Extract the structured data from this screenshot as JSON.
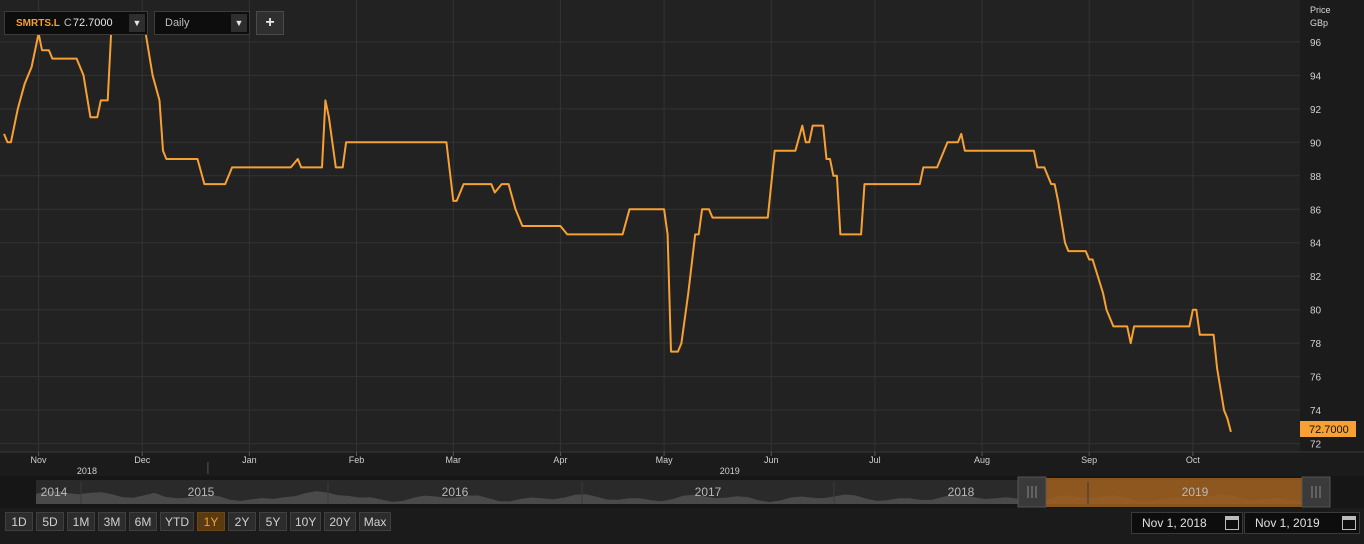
{
  "toolbar": {
    "symbol": "SMRTS.L",
    "close_label": "C",
    "close_value": "72.7000",
    "interval": "Daily",
    "add_label": "+"
  },
  "axis": {
    "title_line1": "Price",
    "title_line2": "GBp",
    "last_price": "72.7000"
  },
  "navigator": {
    "years": [
      "2014",
      "2015",
      "2016",
      "2017",
      "2018",
      "2019"
    ]
  },
  "range_buttons": [
    "1D",
    "5D",
    "1M",
    "3M",
    "6M",
    "YTD",
    "1Y",
    "2Y",
    "5Y",
    "10Y",
    "20Y",
    "Max"
  ],
  "active_range": "1Y",
  "dates": {
    "start": "Nov 1, 2018",
    "end": "Nov 1, 2019"
  },
  "colors": {
    "line": "#f7a033",
    "background": "#222222",
    "grid": "#3a3a3a",
    "navigator_selection": "#a05f1e"
  },
  "chart_data": {
    "type": "line",
    "title": "",
    "xlabel": "",
    "ylabel": "Price GBp",
    "ylim": [
      71.5,
      98.5
    ],
    "y_ticks": [
      72,
      74,
      76,
      78,
      80,
      82,
      84,
      86,
      88,
      90,
      92,
      94,
      96
    ],
    "month_ticks": [
      {
        "label": "Nov",
        "x": "2018-11-01"
      },
      {
        "label": "Dec",
        "x": "2018-12-01"
      },
      {
        "label": "Jan",
        "x": "2019-01-01"
      },
      {
        "label": "Feb",
        "x": "2019-02-01"
      },
      {
        "label": "Mar",
        "x": "2019-03-01"
      },
      {
        "label": "Apr",
        "x": "2019-04-01"
      },
      {
        "label": "May",
        "x": "2019-05-01"
      },
      {
        "label": "Jun",
        "x": "2019-06-01"
      },
      {
        "label": "Jul",
        "x": "2019-07-01"
      },
      {
        "label": "Aug",
        "x": "2019-08-01"
      },
      {
        "label": "Sep",
        "x": "2019-09-01"
      },
      {
        "label": "Oct",
        "x": "2019-10-01"
      }
    ],
    "year_labels": [
      {
        "label": "2018",
        "x": "2018-11-15"
      },
      {
        "label": "2019",
        "x": "2019-05-20"
      }
    ],
    "x_range": [
      "2018-10-22",
      "2019-11-01"
    ],
    "series": [
      {
        "name": "SMRTS.L",
        "points": [
          [
            "2018-10-22",
            90.5
          ],
          [
            "2018-10-23",
            90.0
          ],
          [
            "2018-10-24",
            90.0
          ],
          [
            "2018-10-26",
            92.0
          ],
          [
            "2018-10-28",
            93.5
          ],
          [
            "2018-10-30",
            94.5
          ],
          [
            "2018-11-01",
            96.5
          ],
          [
            "2018-11-02",
            95.5
          ],
          [
            "2018-11-04",
            95.5
          ],
          [
            "2018-11-05",
            95.0
          ],
          [
            "2018-11-12",
            95.0
          ],
          [
            "2018-11-14",
            94.0
          ],
          [
            "2018-11-16",
            91.5
          ],
          [
            "2018-11-18",
            91.5
          ],
          [
            "2018-11-19",
            92.5
          ],
          [
            "2018-11-21",
            92.5
          ],
          [
            "2018-11-22",
            96.5
          ],
          [
            "2018-12-02",
            96.5
          ],
          [
            "2018-12-04",
            94.0
          ],
          [
            "2018-12-06",
            92.5
          ],
          [
            "2018-12-07",
            89.5
          ],
          [
            "2018-12-08",
            89.0
          ],
          [
            "2018-12-17",
            89.0
          ],
          [
            "2018-12-19",
            87.5
          ],
          [
            "2018-12-25",
            87.5
          ],
          [
            "2018-12-27",
            88.5
          ],
          [
            "2019-01-13",
            88.5
          ],
          [
            "2019-01-15",
            89.0
          ],
          [
            "2019-01-16",
            88.5
          ],
          [
            "2019-01-22",
            88.5
          ],
          [
            "2019-01-23",
            92.5
          ],
          [
            "2019-01-24",
            91.5
          ],
          [
            "2019-01-26",
            88.5
          ],
          [
            "2019-01-28",
            88.5
          ],
          [
            "2019-01-29",
            90.0
          ],
          [
            "2019-02-27",
            90.0
          ],
          [
            "2019-03-01",
            86.5
          ],
          [
            "2019-03-02",
            86.5
          ],
          [
            "2019-03-04",
            87.5
          ],
          [
            "2019-03-12",
            87.5
          ],
          [
            "2019-03-13",
            87.0
          ],
          [
            "2019-03-15",
            87.5
          ],
          [
            "2019-03-17",
            87.5
          ],
          [
            "2019-03-19",
            86.0
          ],
          [
            "2019-03-21",
            85.0
          ],
          [
            "2019-04-01",
            85.0
          ],
          [
            "2019-04-03",
            84.5
          ],
          [
            "2019-04-19",
            84.5
          ],
          [
            "2019-04-21",
            86.0
          ],
          [
            "2019-05-01",
            86.0
          ],
          [
            "2019-05-02",
            84.5
          ],
          [
            "2019-05-03",
            77.5
          ],
          [
            "2019-05-05",
            77.5
          ],
          [
            "2019-05-06",
            78.0
          ],
          [
            "2019-05-08",
            81.0
          ],
          [
            "2019-05-10",
            84.5
          ],
          [
            "2019-05-11",
            84.5
          ],
          [
            "2019-05-12",
            86.0
          ],
          [
            "2019-05-14",
            86.0
          ],
          [
            "2019-05-15",
            85.5
          ],
          [
            "2019-05-31",
            85.5
          ],
          [
            "2019-06-02",
            89.5
          ],
          [
            "2019-06-08",
            89.5
          ],
          [
            "2019-06-10",
            91.0
          ],
          [
            "2019-06-11",
            90.0
          ],
          [
            "2019-06-12",
            90.0
          ],
          [
            "2019-06-13",
            91.0
          ],
          [
            "2019-06-16",
            91.0
          ],
          [
            "2019-06-17",
            89.0
          ],
          [
            "2019-06-18",
            89.0
          ],
          [
            "2019-06-19",
            88.0
          ],
          [
            "2019-06-20",
            88.0
          ],
          [
            "2019-06-21",
            84.5
          ],
          [
            "2019-06-27",
            84.5
          ],
          [
            "2019-06-28",
            87.5
          ],
          [
            "2019-07-14",
            87.5
          ],
          [
            "2019-07-15",
            88.5
          ],
          [
            "2019-07-19",
            88.5
          ],
          [
            "2019-07-21",
            89.5
          ],
          [
            "2019-07-22",
            90.0
          ],
          [
            "2019-07-25",
            90.0
          ],
          [
            "2019-07-26",
            90.5
          ],
          [
            "2019-07-27",
            89.5
          ],
          [
            "2019-08-16",
            89.5
          ],
          [
            "2019-08-17",
            88.5
          ],
          [
            "2019-08-19",
            88.5
          ],
          [
            "2019-08-21",
            87.5
          ],
          [
            "2019-08-22",
            87.5
          ],
          [
            "2019-08-23",
            86.5
          ],
          [
            "2019-08-25",
            84.0
          ],
          [
            "2019-08-26",
            83.5
          ],
          [
            "2019-08-31",
            83.5
          ],
          [
            "2019-09-01",
            83.0
          ],
          [
            "2019-09-02",
            83.0
          ],
          [
            "2019-09-05",
            81.0
          ],
          [
            "2019-09-06",
            80.0
          ],
          [
            "2019-09-08",
            79.0
          ],
          [
            "2019-09-12",
            79.0
          ],
          [
            "2019-09-13",
            78.0
          ],
          [
            "2019-09-14",
            79.0
          ],
          [
            "2019-09-30",
            79.0
          ],
          [
            "2019-10-01",
            80.0
          ],
          [
            "2019-10-02",
            80.0
          ],
          [
            "2019-10-03",
            78.5
          ],
          [
            "2019-10-07",
            78.5
          ],
          [
            "2019-10-08",
            76.5
          ],
          [
            "2019-10-10",
            74.0
          ],
          [
            "2019-10-11",
            73.5
          ],
          [
            "2019-10-12",
            72.7
          ]
        ]
      }
    ]
  }
}
